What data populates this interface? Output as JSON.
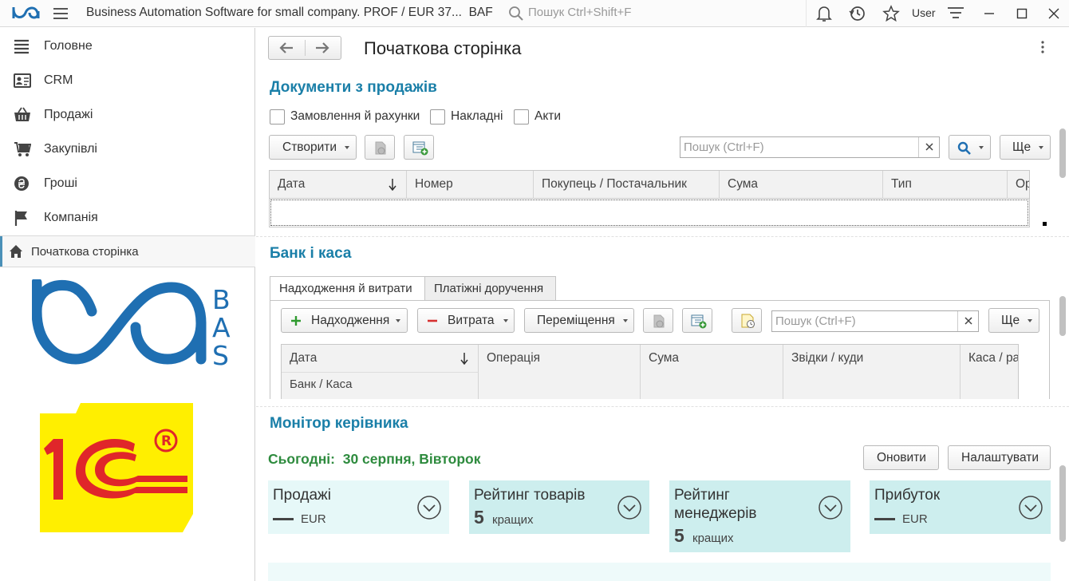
{
  "titlebar": {
    "app_title": "Business Automation Software for small company. PROF / EUR 37...",
    "app_short": "BAF",
    "search_placeholder": "Пошук Ctrl+Shift+F",
    "user": "User"
  },
  "sidebar": {
    "items": [
      {
        "label": "Головне",
        "icon": "list-icon"
      },
      {
        "label": "CRM",
        "icon": "contact-card-icon"
      },
      {
        "label": "Продажі",
        "icon": "basket-icon"
      },
      {
        "label": "Закупівлі",
        "icon": "cart-icon"
      },
      {
        "label": "Гроші",
        "icon": "coin-icon"
      },
      {
        "label": "Компанія",
        "icon": "flag-icon"
      }
    ],
    "home": {
      "label": "Початкова сторінка",
      "icon": "home-icon"
    },
    "bas_letters": [
      "B",
      "A",
      "S"
    ],
    "onec_logo": "1С®"
  },
  "main": {
    "page_title": "Початкова сторінка",
    "sales_docs": {
      "title": "Документи з продажів",
      "filters": [
        "Замовлення й рахунки",
        "Накладні",
        "Акти"
      ],
      "create_label": "Створити",
      "search_placeholder": "Пошук (Ctrl+F)",
      "more_label": "Ще",
      "columns": [
        "Дата",
        "Номер",
        "Покупець / Постачальник",
        "Сума",
        "Тип",
        "Ор"
      ]
    },
    "bank": {
      "title": "Банк і каса",
      "tabs": [
        "Надходження й витрати",
        "Платіжні доручення"
      ],
      "income_label": "Надходження",
      "expense_label": "Витрата",
      "transfer_label": "Переміщення",
      "search_placeholder": "Пошук (Ctrl+F)",
      "more_label": "Ще",
      "columns": [
        "Дата",
        "Операція",
        "Сума",
        "Звідки / куди",
        "Каса / ра"
      ],
      "subheader": "Банк / Каса"
    },
    "monitor": {
      "title": "Монітор керівника",
      "today_label": "Сьогодні:",
      "today_date": "30 серпня, Вівторок",
      "refresh_label": "Оновити",
      "settings_label": "Налаштувати",
      "cards": [
        {
          "title": "Продажі",
          "value": "—",
          "sub": "EUR"
        },
        {
          "title": "Рейтинг товарів",
          "value": "5",
          "sub": "кращих"
        },
        {
          "title": "Рейтинг менеджерів",
          "value": "5",
          "sub": "кращих"
        },
        {
          "title": "Прибуток",
          "value": "—",
          "sub": "EUR"
        }
      ]
    }
  },
  "colors": {
    "accent": "#1a7fa8",
    "today": "#2e8b3e",
    "card_bg": "#cdeeee",
    "logo_blue": "#1f6fb2",
    "onec_red": "#e0262a",
    "onec_yellow": "#ffef00"
  }
}
